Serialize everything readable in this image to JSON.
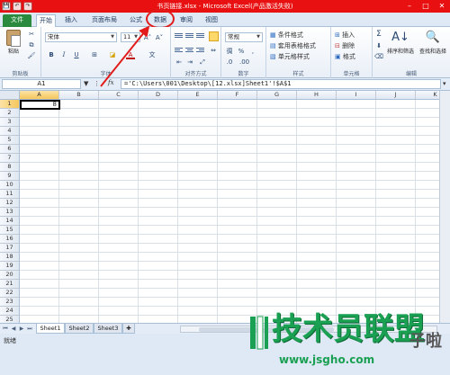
{
  "window": {
    "title": "书页链接.xlsx - Microsoft Excel(产品激活失败)",
    "minimize": "–",
    "maximize": "□",
    "close": "✕"
  },
  "quick_access": [
    "💾",
    "↶",
    "↷"
  ],
  "tabs": [
    {
      "label": "文件",
      "kind": "file"
    },
    {
      "label": "开始",
      "kind": "active"
    },
    {
      "label": "插入"
    },
    {
      "label": "页面布局"
    },
    {
      "label": "公式"
    },
    {
      "label": "数据",
      "highlighted": true
    },
    {
      "label": "审阅"
    },
    {
      "label": "视图"
    }
  ],
  "ribbon": {
    "clipboard": {
      "paste": "粘贴",
      "label": "剪贴板"
    },
    "font": {
      "name": "宋体",
      "size": "11",
      "label": "字体",
      "bold": "B",
      "italic": "I",
      "underline": "U",
      "grow": "A˄",
      "shrink": "A˅",
      "fontcolor": "A"
    },
    "alignment": {
      "label": "对齐方式"
    },
    "number": {
      "format": "常规",
      "currency": "徟",
      "percent": "%",
      "comma": ",",
      "label": "数字"
    },
    "styles": {
      "conditional": "条件格式",
      "table": "套用表格格式",
      "cell": "单元格样式",
      "label": "样式"
    },
    "cells": {
      "insert": "插入",
      "delete": "删除",
      "format": "格式",
      "label": "单元格"
    },
    "editing": {
      "sum": "Σ",
      "sort": "排序和筛选",
      "find": "查找和选择",
      "label": "编辑"
    }
  },
  "formula_bar": {
    "name_box": "A1",
    "fx": "fx",
    "formula": "='C:\\Users\\001\\Desktop\\[12.xlsx]Sheet1'!$A$1"
  },
  "columns": [
    "A",
    "B",
    "C",
    "D",
    "E",
    "F",
    "G",
    "H",
    "I",
    "J",
    "K",
    "L"
  ],
  "rows": [
    "1",
    "2",
    "3",
    "4",
    "5",
    "6",
    "7",
    "8",
    "9",
    "10",
    "11",
    "12",
    "13",
    "14",
    "15",
    "16",
    "17",
    "18",
    "19",
    "20",
    "21",
    "22",
    "23",
    "24",
    "25"
  ],
  "active_cell": {
    "ref": "A1",
    "value": "8"
  },
  "sheets": [
    "Sheet1",
    "Sheet2",
    "Sheet3"
  ],
  "status": "就绪",
  "watermark": {
    "text": "技术员联盟",
    "suffix": "子啦",
    "url": "www.jsgho.com"
  }
}
